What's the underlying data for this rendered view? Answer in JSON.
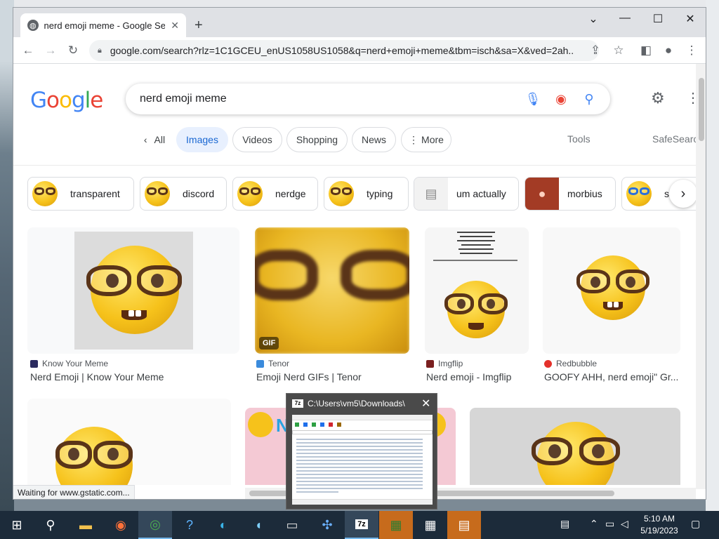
{
  "browser": {
    "tab_title": "nerd emoji meme - Google Search",
    "tab_icon": "globe-icon",
    "url": "google.com/search?rlz=1C1GCEU_enUS1058US1058&q=nerd+emoji+meme&tbm=isch&sa=X&ved=2ah..."
  },
  "google": {
    "logo": [
      "G",
      "o",
      "o",
      "g",
      "l",
      "e"
    ],
    "logo_colors": [
      "#4285f4",
      "#ea4335",
      "#fbbc05",
      "#4285f4",
      "#34a853",
      "#ea4335"
    ],
    "query": "nerd emoji meme"
  },
  "nav": {
    "all": "All",
    "images": "Images",
    "videos": "Videos",
    "shopping": "Shopping",
    "news": "News",
    "more": "More",
    "tools": "Tools",
    "safesearch": "SafeSearch"
  },
  "related": [
    "transparent",
    "discord",
    "nerdge",
    "typing",
    "um actually",
    "morbius",
    "smiling"
  ],
  "results_row1": [
    {
      "source": "Know Your Meme",
      "title": "Nerd Emoji | Know Your Meme",
      "fav": "#2b2b5f"
    },
    {
      "source": "Tenor",
      "title": "Emoji Nerd GIFs | Tenor",
      "fav": "#3b8bdc",
      "badge": "GIF"
    },
    {
      "source": "Imgflip",
      "title": "Nerd emoji - Imgflip",
      "fav": "#7a1f1f"
    },
    {
      "source": "Redbubble",
      "title": "GOOFY AHH, nerd emoji\" Gr...",
      "fav": "#e4312b"
    }
  ],
  "status_text": "Waiting for www.gstatic.com...",
  "thumbnail_popup": {
    "title": "C:\\Users\\vm5\\Downloads\\",
    "app_icon": "7z"
  },
  "taskbar": {
    "time": "5:10 AM",
    "date": "5/19/2023"
  }
}
